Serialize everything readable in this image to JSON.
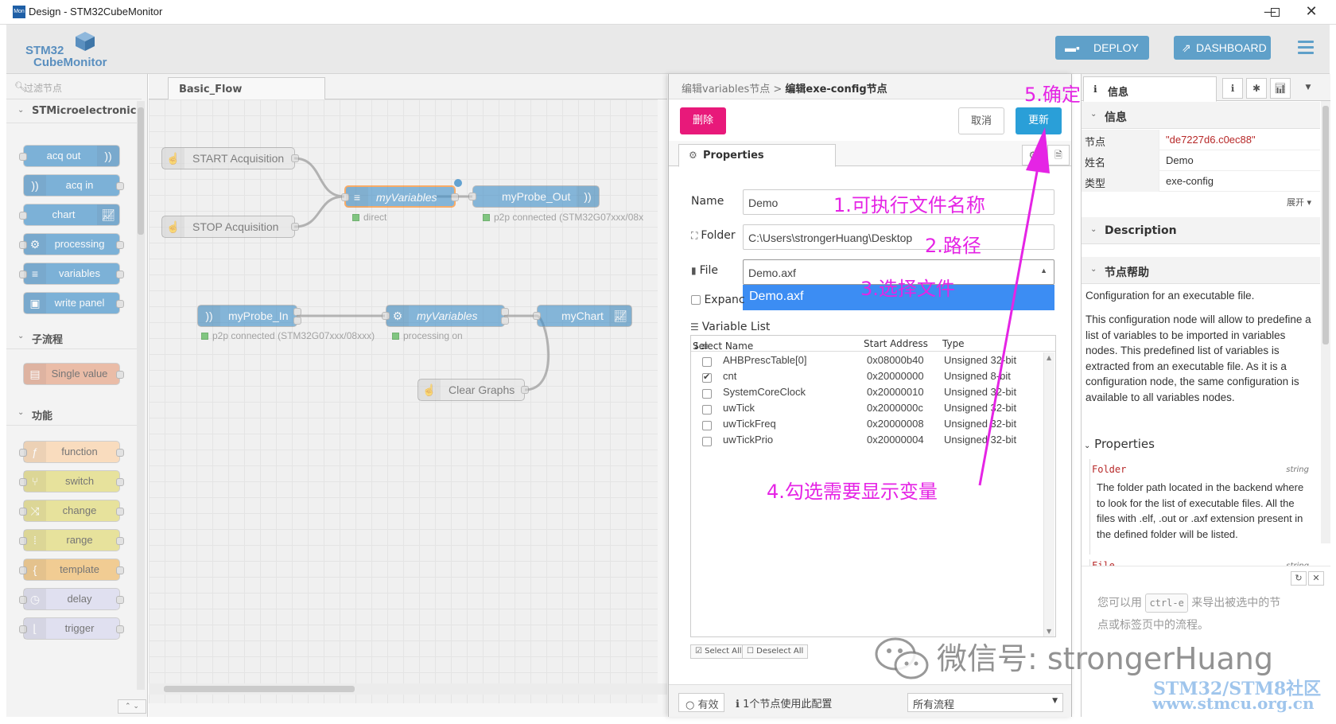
{
  "window": {
    "title": "Design - STM32CubeMonitor",
    "icon_text": "Mon"
  },
  "header": {
    "logo_line1": "STM32",
    "logo_line2": "CubeMonitor",
    "deploy_label": "DEPLOY",
    "dashboard_label": "DASHBOARD"
  },
  "palette": {
    "filter_placeholder": "过滤节点",
    "categories": [
      "STMicroelectronics",
      "子流程",
      "功能"
    ],
    "st_nodes": [
      "acq out",
      "acq in",
      "chart",
      "processing",
      "variables",
      "write panel"
    ],
    "subflow_nodes": [
      "Single value"
    ],
    "function_nodes": [
      "function",
      "switch",
      "change",
      "range",
      "template",
      "delay",
      "trigger"
    ]
  },
  "workspace": {
    "tab_label": "Basic_Flow",
    "nodes": {
      "start": "START Acquisition",
      "stop": "STOP Acquisition",
      "myvars1": "myVariables",
      "probe_out": "myProbe_Out",
      "probe_in": "myProbe_In",
      "myvars2": "myVariables",
      "mychart": "myChart",
      "clear": "Clear Graphs"
    },
    "status": {
      "direct": "direct",
      "p2p_out": "p2p connected (STM32G07xxx/08x",
      "p2p_in": "p2p connected (STM32G07xxx/08xxx)",
      "processing": "processing on"
    }
  },
  "editor": {
    "breadcrumb_parent": "编辑variables节点 >",
    "breadcrumb_current": "编辑exe-config节点",
    "delete_label": "删除",
    "cancel_label": "取消",
    "update_label": "更新",
    "tab_label": "Properties",
    "name_label": "Name",
    "name_value": "Demo",
    "folder_label": "Folder",
    "folder_value": "C:\\Users\\strongerHuang\\Desktop",
    "file_label": "File",
    "file_value": "Demo.axf",
    "file_option": "Demo.axf",
    "expand_label": "Expanc",
    "variable_list_label": "Variable List",
    "columns": {
      "select_name": "Select Name",
      "start_address": "Start Address",
      "type": "Type"
    },
    "variables": [
      {
        "name": "AHBPrescTable[0]",
        "address": "0x08000b40",
        "type": "Unsigned 32-bit",
        "checked": false
      },
      {
        "name": "cnt",
        "address": "0x20000000",
        "type": "Unsigned 8-bit",
        "checked": true
      },
      {
        "name": "SystemCoreClock",
        "address": "0x20000010",
        "type": "Unsigned 32-bit",
        "checked": false
      },
      {
        "name": "uwTick",
        "address": "0x2000000c",
        "type": "Unsigned 32-bit",
        "checked": false
      },
      {
        "name": "uwTickFreq",
        "address": "0x20000008",
        "type": "Unsigned 32-bit",
        "checked": false
      },
      {
        "name": "uwTickPrio",
        "address": "0x20000004",
        "type": "Unsigned 32-bit",
        "checked": false
      }
    ],
    "select_all": "Select All",
    "deselect_all": "Deselect All",
    "valid_label": "有效",
    "usage_text": "1个节点使用此配置",
    "scope_value": "所有流程"
  },
  "annotations": {
    "a1": "1.可执行文件名称",
    "a2": "2.路径",
    "a3": "3.选择文件",
    "a4": "4.勾选需要显示变量",
    "a5": "5.确定",
    "color": "#e524e5"
  },
  "sidebar": {
    "tab_label": "信息",
    "info_section": "信息",
    "rows": [
      {
        "key": "节点",
        "value": "\"de7227d6.c0ec88\""
      },
      {
        "key": "姓名",
        "value": "Demo"
      },
      {
        "key": "类型",
        "value": "exe-config"
      }
    ],
    "expand_label": "展开",
    "description_section": "Description",
    "help_section": "节点帮助",
    "help_intro": "Configuration for an executable file.",
    "help_para": "This configuration node will allow to predefine a list of variables to be imported in variables nodes. This predefined list of variables is extracted from an executable file. As it is a configuration node, the same configuration is available to all variables nodes.",
    "properties_heading": "Properties",
    "prop_folder_name": "Folder",
    "prop_folder_type": "string",
    "prop_folder_desc": "The folder path located in the backend where to look for the list of executable files. All the files with .elf, .out or .axf extension present in the defined folder will be listed.",
    "prop_file_name": "File",
    "prop_file_type": "string",
    "tip_before": "您可以用",
    "tip_key": "ctrl-e",
    "tip_after": "来导出被选中的节",
    "tip_line2": "点或标签页中的流程。"
  },
  "watermark": {
    "wechat": "微信号: strongerHuang",
    "site_name": "STM32/STM8社区",
    "site_url": "www.stmcu.org.cn"
  },
  "colors": {
    "accent": "#2a9fd8",
    "delete": "#e8197a",
    "annotation": "#e524e5",
    "st_node": "#3e8fc9",
    "function_node": "#fdd0a2"
  }
}
